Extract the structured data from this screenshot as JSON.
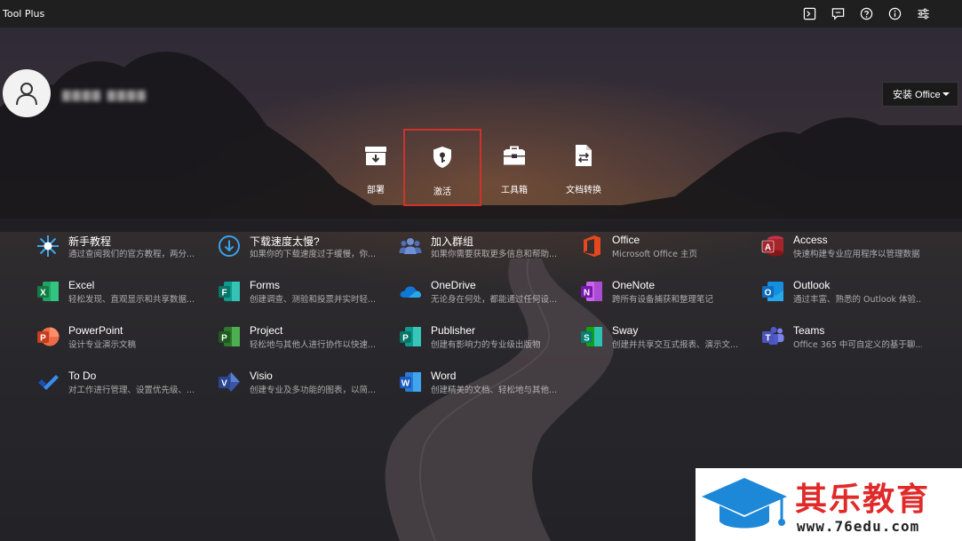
{
  "window": {
    "title": "Tool Plus"
  },
  "titlebar_icons": [
    "terminal-icon",
    "feedback-icon",
    "help-icon",
    "info-icon",
    "settings-sliders-icon"
  ],
  "user": {
    "name": "▇▇▇▇  ▇▇▇▇"
  },
  "install_button": {
    "label": "安装 Office"
  },
  "actions": [
    {
      "label": "部署",
      "icon": "deploy-icon"
    },
    {
      "label": "激活",
      "icon": "activate-key-icon"
    },
    {
      "label": "工具箱",
      "icon": "toolbox-icon"
    },
    {
      "label": "文档转换",
      "icon": "document-convert-icon"
    }
  ],
  "apps": [
    {
      "name": "新手教程",
      "desc": "通过查阅我们的官方教程，两分...",
      "icon": "tutorial-icon",
      "color": "#3aa0e8"
    },
    {
      "name": "下载速度太慢?",
      "desc": "如果你的下载速度过于缓慢，你...",
      "icon": "download-icon",
      "color": "#3aa0e8"
    },
    {
      "name": "加入群组",
      "desc": "如果你需要获取更多信息和帮助...",
      "icon": "group-icon",
      "color": "#5b7fc6"
    },
    {
      "name": "Office",
      "desc": "Microsoft Office 主页",
      "icon": "office-icon",
      "color": "#e5481f"
    },
    {
      "name": "Access",
      "desc": "快速构建专业应用程序以管理数据",
      "icon": "access-icon",
      "color": "#a4262c"
    },
    {
      "name": "Excel",
      "desc": "轻松发现、直观显示和共享数据...",
      "icon": "excel-icon",
      "color": "#1d7044"
    },
    {
      "name": "Forms",
      "desc": "创建调查、测验和投票并实时轻...",
      "icon": "forms-icon",
      "color": "#077568"
    },
    {
      "name": "OneDrive",
      "desc": "无论身在何处，都能通过任何设...",
      "icon": "onedrive-icon",
      "color": "#0f78d4"
    },
    {
      "name": "OneNote",
      "desc": "跨所有设备捕获和整理笔记",
      "icon": "onenote-icon",
      "color": "#7719aa"
    },
    {
      "name": "Outlook",
      "desc": "通过丰富、熟悉的 Outlook 体验...",
      "icon": "outlook-icon",
      "color": "#0f6cbd"
    },
    {
      "name": "PowerPoint",
      "desc": "设计专业演示文稿",
      "icon": "powerpoint-icon",
      "color": "#c43e1c"
    },
    {
      "name": "Project",
      "desc": "轻松地与其他人进行协作以快速...",
      "icon": "project-icon",
      "color": "#1d7044"
    },
    {
      "name": "Publisher",
      "desc": "创建有影响力的专业级出版物",
      "icon": "publisher-icon",
      "color": "#077568"
    },
    {
      "name": "Sway",
      "desc": "创建并共享交互式报表、演示文...",
      "icon": "sway-icon",
      "color": "#008272"
    },
    {
      "name": "Teams",
      "desc": "Office 365 中可自定义的基于聊...",
      "icon": "teams-icon",
      "color": "#5059c9"
    },
    {
      "name": "To Do",
      "desc": "对工作进行管理、设置优先级、...",
      "icon": "todo-icon",
      "color": "#2564cf"
    },
    {
      "name": "Visio",
      "desc": "创建专业及多功能的图表，以简...",
      "icon": "visio-icon",
      "color": "#3955a3"
    },
    {
      "name": "Word",
      "desc": "创建精美的文档、轻松地与其他...",
      "icon": "word-icon",
      "color": "#185abd"
    }
  ],
  "watermark": {
    "text": "其乐教育",
    "url": "www.76edu.com",
    "icon": "graduation-cap-icon",
    "color": "#1e88d8"
  }
}
